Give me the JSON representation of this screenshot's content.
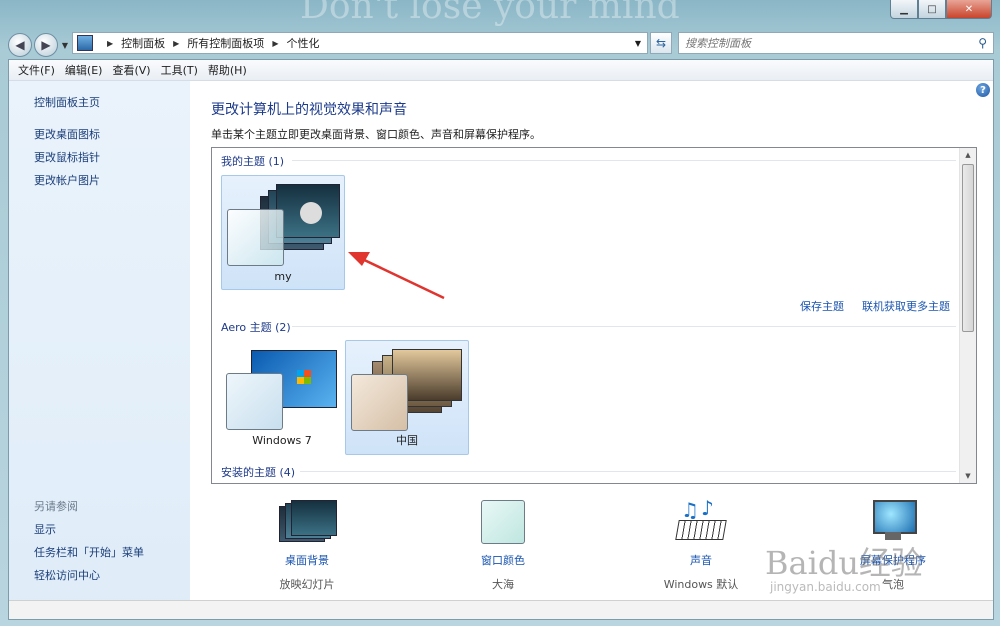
{
  "window": {
    "watermark_text": "Don't lose your mind",
    "caption": {
      "minimize": "▁",
      "maximize": "□",
      "close": "✕"
    }
  },
  "address": {
    "crumbs": [
      "控制面板",
      "所有控制面板项",
      "个性化"
    ]
  },
  "search": {
    "placeholder": "搜索控制面板"
  },
  "menu": [
    "文件(F)",
    "编辑(E)",
    "查看(V)",
    "工具(T)",
    "帮助(H)"
  ],
  "sidebar": {
    "links": [
      "控制面板主页",
      "更改桌面图标",
      "更改鼠标指针",
      "更改帐户图片"
    ],
    "see_also_header": "另请参阅",
    "see_also": [
      "显示",
      "任务栏和「开始」菜单",
      "轻松访问中心"
    ]
  },
  "main": {
    "title": "更改计算机上的视觉效果和声音",
    "subtitle": "单击某个主题立即更改桌面背景、窗口颜色、声音和屏幕保护程序。",
    "help_icon": "?"
  },
  "gallery": {
    "my_themes_header": "我的主题 (1)",
    "my_themes": [
      {
        "label": "my"
      }
    ],
    "save_link": "保存主题",
    "online_link": "联机获取更多主题",
    "aero_header": "Aero 主题 (2)",
    "aero_themes": [
      {
        "label": "Windows 7"
      },
      {
        "label": "中国"
      }
    ],
    "installed_header": "安装的主题 (4)"
  },
  "bottom": [
    {
      "link": "桌面背景",
      "sub": "放映幻灯片",
      "icon": "desktop-background-icon"
    },
    {
      "link": "窗口颜色",
      "sub": "大海",
      "icon": "window-color-icon"
    },
    {
      "link": "声音",
      "sub": "Windows 默认",
      "icon": "music-notes-icon"
    },
    {
      "link": "屏幕保护程序",
      "sub": "气泡",
      "icon": "screensaver-monitor-icon"
    }
  ],
  "watermark": {
    "logo": "Baidu经验",
    "url": "jingyan.baidu.com"
  },
  "colors": {
    "link": "#1a55b0",
    "title": "#1d3b8c",
    "sidebar_bg": "#dfecf8",
    "arrow": "#e0342e"
  }
}
